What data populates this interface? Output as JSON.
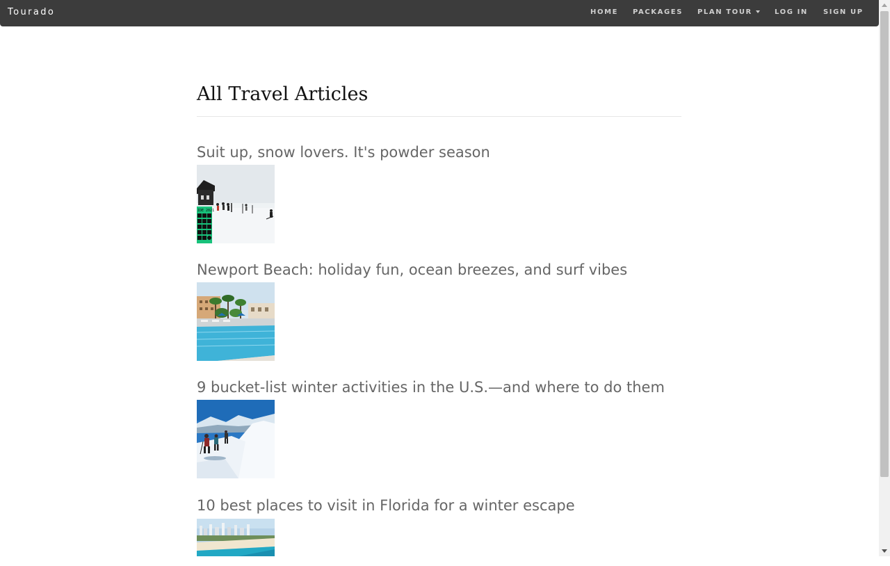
{
  "navbar": {
    "brand": "Tourado",
    "items": [
      {
        "label": "HOME"
      },
      {
        "label": "PACKAGES"
      },
      {
        "label": "PLAN TOUR"
      },
      {
        "label": "LOG IN"
      },
      {
        "label": "SIGN UP"
      }
    ]
  },
  "main": {
    "title": "All Travel Articles",
    "articles": [
      {
        "title": "Suit up, snow lovers. It's powder season",
        "badge": "IDE 2021"
      },
      {
        "title": "Newport Beach: holiday fun, ocean breezes, and surf vibes"
      },
      {
        "title": "9 bucket-list winter activities in the U.S.—and where to do them"
      },
      {
        "title": "10 best places to visit in Florida for a winter escape"
      }
    ]
  },
  "colors": {
    "navbar_bg": "#3c3c3c",
    "nav_text": "#cfcfcf",
    "article_title": "#666666",
    "heading": "#111111"
  }
}
